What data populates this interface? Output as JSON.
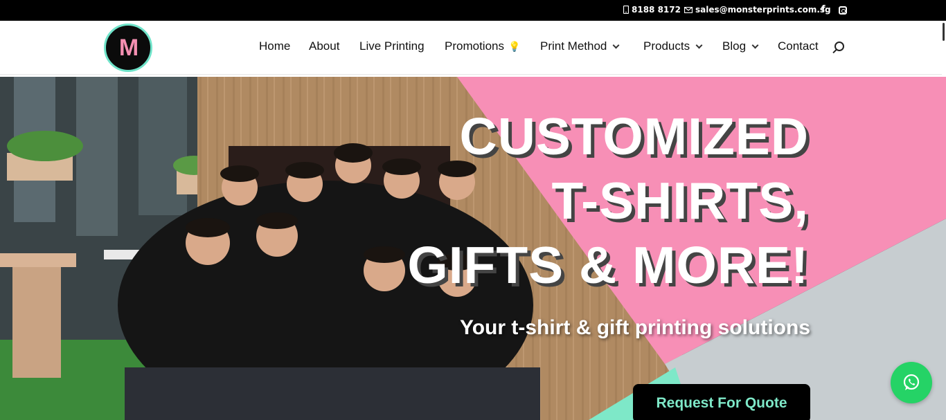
{
  "topbar": {
    "phone": "8188 8172",
    "email": "sales@monsterprints.com.sg",
    "icons": [
      "phone-icon",
      "mail-icon",
      "facebook-icon",
      "instagram-icon"
    ]
  },
  "header": {
    "logo_text": "M",
    "nav": [
      {
        "label": "Home",
        "dropdown": false
      },
      {
        "label": "About",
        "dropdown": false
      },
      {
        "label": "Live Printing",
        "dropdown": false
      },
      {
        "label": "Promotions",
        "dropdown": false,
        "icon": "lightbulb-icon"
      },
      {
        "label": "Print Method",
        "dropdown": true
      },
      {
        "label": "Products",
        "dropdown": true
      },
      {
        "label": "Blog",
        "dropdown": true
      },
      {
        "label": "Contact",
        "dropdown": false
      }
    ]
  },
  "hero": {
    "headline_line1": "CUSTOMIZED",
    "headline_line2": "T-SHIRTS,",
    "headline_line3": "GIFTS & MORE!",
    "subheadline": "Your t-shirt & gift printing solutions",
    "cta_label": "Request For Quote",
    "colors": {
      "pink": "#f78fb6",
      "grey": "#c7cdd0",
      "mint": "#7ee8c8",
      "wood": "#b08a62"
    }
  },
  "floating": {
    "whatsapp_icon": "whatsapp-icon"
  }
}
